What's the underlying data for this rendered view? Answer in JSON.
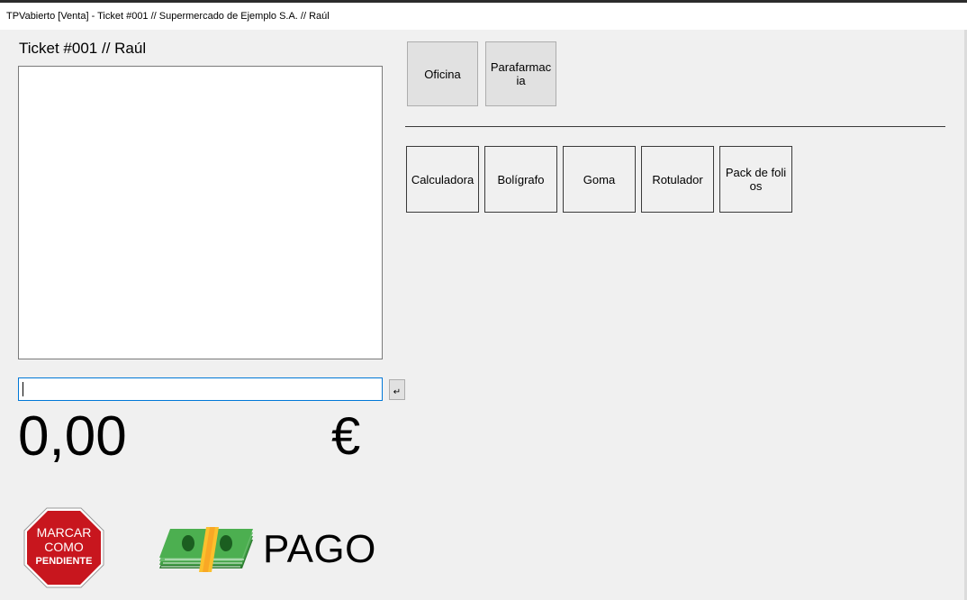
{
  "window": {
    "title": "TPVabierto [Venta] - Ticket #001 // Supermercado de Ejemplo S.A. // Raúl"
  },
  "ticket": {
    "header": "Ticket #001 // Raúl",
    "items": [],
    "input_value": "",
    "enter_glyph": "↵",
    "total": "0,00",
    "currency": "€"
  },
  "categories": [
    {
      "label": "Oficina"
    },
    {
      "label": "Parafarmacia"
    }
  ],
  "products": [
    {
      "label": "Calculadora"
    },
    {
      "label": "Bolígrafo"
    },
    {
      "label": "Goma"
    },
    {
      "label": "Rotulador"
    },
    {
      "label": "Pack de folios"
    }
  ],
  "actions": {
    "pending": {
      "line1": "MARCAR",
      "line2": "COMO",
      "line3": "PENDIENTE",
      "icon": "stop-sign-icon",
      "color": "#c8161e"
    },
    "pay": {
      "label": "PAGO",
      "icon": "money-stack-icon",
      "color": "#4caf50"
    }
  }
}
